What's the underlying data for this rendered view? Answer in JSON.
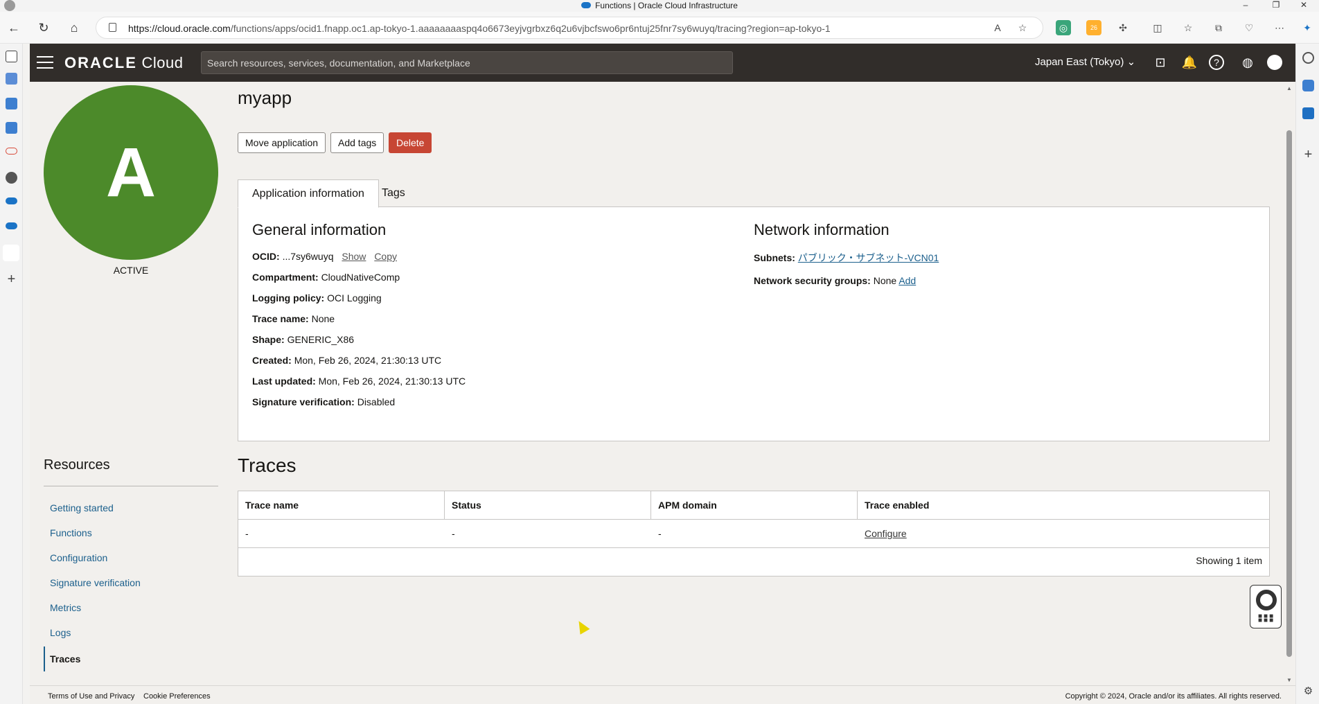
{
  "window": {
    "title": "Functions | Oracle Cloud Infrastructure",
    "minimize": "–",
    "restore": "❐",
    "close": "✕"
  },
  "browser": {
    "url_host": "https://cloud.oracle.com",
    "url_path": "/functions/apps/ocid1.fnapp.oc1.ap-tokyo-1.aaaaaaaaspq4o6673eyjvgrbxz6q2u6vjbcfswo6pr6ntuj25fnr7sy6wuyq/tracing?region=ap-tokyo-1",
    "ext_badge": "26"
  },
  "header": {
    "brand_oracle": "ORACLE",
    "brand_cloud": "Cloud",
    "search_placeholder": "Search resources, services, documentation, and Marketplace",
    "region": "Japan East (Tokyo)"
  },
  "app": {
    "avatar_letter": "A",
    "status": "ACTIVE",
    "name": "myapp",
    "buttons": {
      "move": "Move application",
      "add_tags": "Add tags",
      "delete": "Delete"
    }
  },
  "tabs": [
    {
      "label": "Application information"
    },
    {
      "label": "Tags"
    }
  ],
  "general": {
    "title": "General information",
    "ocid_label": "OCID:",
    "ocid_value": "...7sy6wuyq",
    "ocid_show": "Show",
    "ocid_copy": "Copy",
    "compartment_label": "Compartment:",
    "compartment_value": "CloudNativeComp",
    "logging_label": "Logging policy:",
    "logging_value": "OCI Logging",
    "trace_label": "Trace name:",
    "trace_value": "None",
    "shape_label": "Shape:",
    "shape_value": "GENERIC_X86",
    "created_label": "Created:",
    "created_value": "Mon, Feb 26, 2024, 21:30:13 UTC",
    "updated_label": "Last updated:",
    "updated_value": "Mon, Feb 26, 2024, 21:30:13 UTC",
    "sig_label": "Signature verification:",
    "sig_value": "Disabled"
  },
  "network": {
    "title": "Network information",
    "subnets_label": "Subnets:",
    "subnets_value": "パブリック・サブネット-VCN01",
    "nsg_label": "Network security groups:",
    "nsg_value": "None",
    "nsg_add": "Add"
  },
  "resources": {
    "title": "Resources",
    "items": [
      {
        "label": "Getting started"
      },
      {
        "label": "Functions"
      },
      {
        "label": "Configuration"
      },
      {
        "label": "Signature verification"
      },
      {
        "label": "Metrics"
      },
      {
        "label": "Logs"
      },
      {
        "label": "Traces"
      }
    ]
  },
  "traces": {
    "title": "Traces",
    "columns": [
      "Trace name",
      "Status",
      "APM domain",
      "Trace enabled"
    ],
    "row": [
      "-",
      "-",
      "-"
    ],
    "configure": "Configure",
    "showing": "Showing 1 item"
  },
  "footer": {
    "terms": "Terms of Use and Privacy",
    "cookies": "Cookie Preferences",
    "copyright": "Copyright © 2024, Oracle and/or its affiliates. All rights reserved."
  },
  "colors": {
    "header_bg": "#312d2a",
    "avatar_green": "#4c8a2a",
    "danger": "#c74634",
    "link": "#1b5f8c"
  }
}
